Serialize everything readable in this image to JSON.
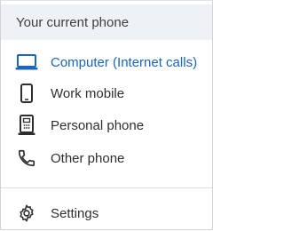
{
  "menu": {
    "header": "Your current phone",
    "items": [
      {
        "label": "Computer (Internet calls)",
        "icon": "laptop-icon",
        "selected": true
      },
      {
        "label": "Work mobile",
        "icon": "mobile-phone-icon",
        "selected": false
      },
      {
        "label": "Personal phone",
        "icon": "desk-phone-icon",
        "selected": false
      },
      {
        "label": "Other phone",
        "icon": "handset-icon",
        "selected": false
      }
    ],
    "settings": {
      "label": "Settings",
      "icon": "gear-icon"
    }
  },
  "colors": {
    "accent": "#1a66b8",
    "header_bg": "#eef2f6",
    "text": "#2e2e2e"
  }
}
